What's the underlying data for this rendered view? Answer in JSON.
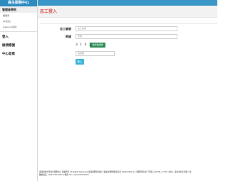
{
  "brand": "員生服務中心",
  "sidebar": {
    "admin_section": "管理者資訊",
    "sub_items": [
      "權限者",
      "[IP位址]",
      "[session資訊]"
    ],
    "items": [
      "登入",
      "檢視帳號",
      "中心首頁"
    ]
  },
  "page_title": "志工登入",
  "form": {
    "id_label": "志工編號",
    "id_placeholder": "志工編號",
    "password_label": "密碼",
    "password_placeholder": "密碼",
    "captcha_code": "3 1 4 2",
    "captcha_refresh": "更新驗證碼",
    "captcha_placeholder": "驗證碼",
    "login_button": "登入"
  },
  "footer": {
    "line1": "臺灣師範大學員生服務中心 版權所有 All Rights Reserved 建議瀏覽器 使用下載最新瀏覽器 解析度 1024x768以上 | 服務時間(週一至週五) 08:00~17:00 | 地址：臺北市和平東路一段",
    "line2": "聯絡電話：(02)7734-XXXX | 傳真 Fax：(02) XXXX-XXXX"
  }
}
